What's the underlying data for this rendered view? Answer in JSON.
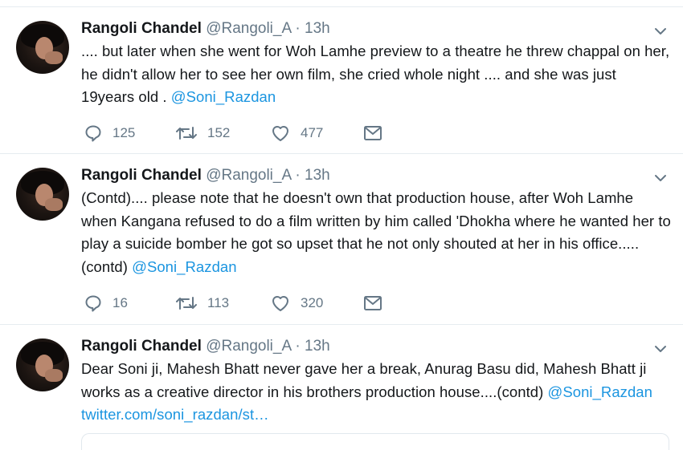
{
  "tweets": [
    {
      "author": "Rangoli Chandel",
      "handle": "@Rangoli_A",
      "separator": "·",
      "time": "13h",
      "text": ".... but later when she went for Woh Lamhe preview to a theatre he threw chappal on her, he didn't allow her to see her own film, she cried whole night .... and she was just 19years old . ",
      "links": [
        "@Soni_Razdan"
      ],
      "replies": "125",
      "retweets": "152",
      "likes": "477"
    },
    {
      "author": "Rangoli Chandel",
      "handle": "@Rangoli_A",
      "separator": "·",
      "time": "13h",
      "text": "(Contd).... please note that he doesn't own that production house, after Woh Lamhe when Kangana refused to do a film written by him called 'Dhokha where he wanted her to play a suicide bomber he got so upset that he not only shouted at her in his office..... (contd) ",
      "links": [
        "@Soni_Razdan"
      ],
      "replies": "16",
      "retweets": "113",
      "likes": "320"
    },
    {
      "author": "Rangoli Chandel",
      "handle": "@Rangoli_A",
      "separator": "·",
      "time": "13h",
      "text": "Dear Soni ji, Mahesh Bhatt never gave her a break, Anurag Basu did, Mahesh Bhatt ji works as a creative director in his brothers production house....(contd) ",
      "links": [
        "@Soni_Razdan",
        "twitter.com/soni_razdan/st…"
      ]
    }
  ],
  "icons": {
    "reply": "speech-bubble",
    "retweet": "retweet-arrows",
    "like": "heart",
    "dm": "envelope",
    "more": "chevron-down"
  },
  "colors": {
    "text": "#14171a",
    "muted": "#657786",
    "link": "#1b95e0",
    "divider": "#e6ecf0"
  }
}
